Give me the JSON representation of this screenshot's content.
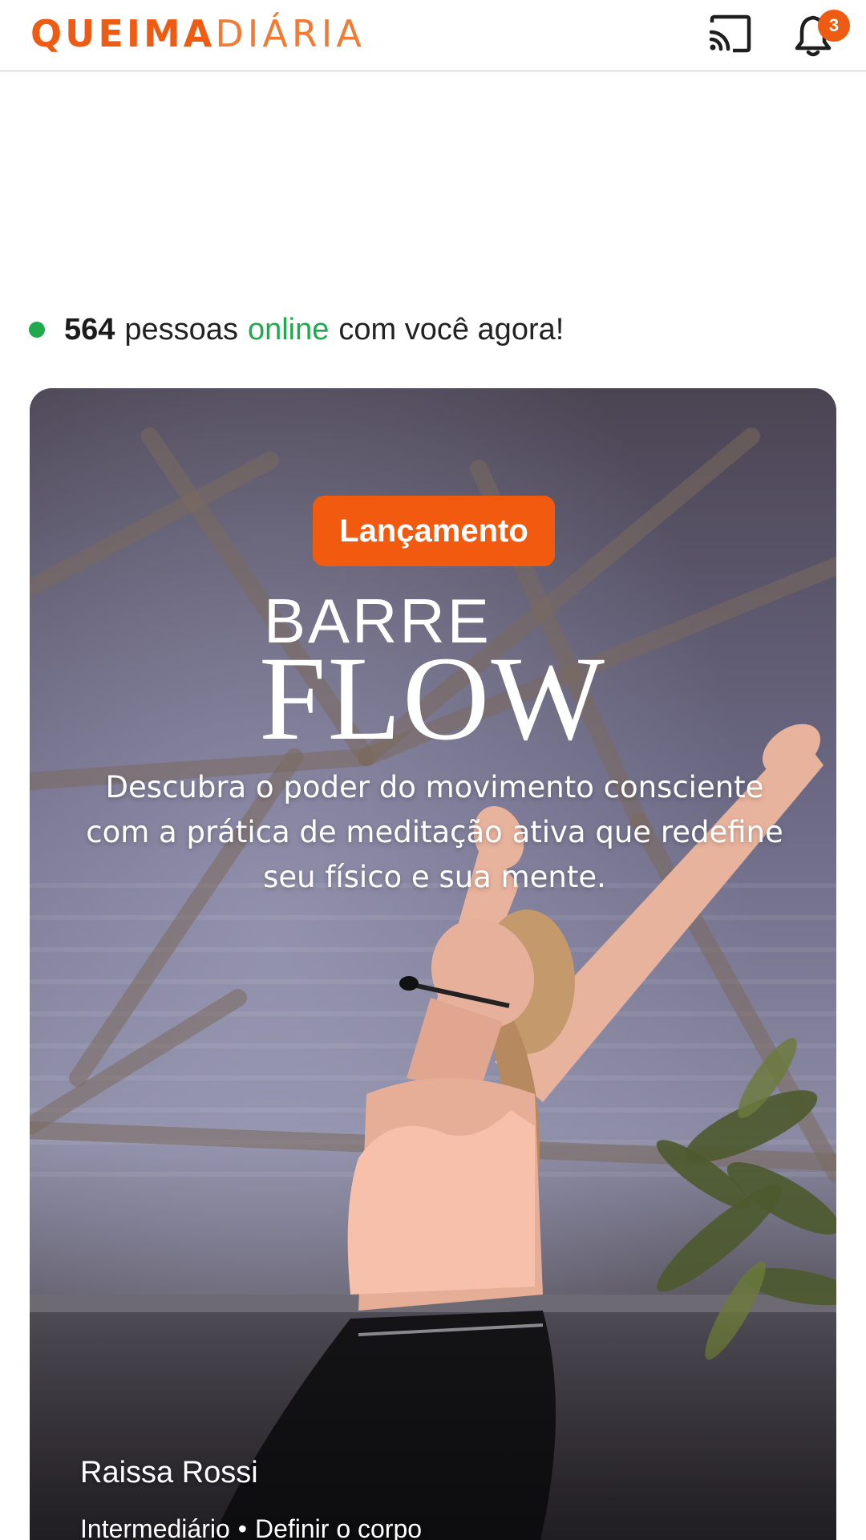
{
  "header": {
    "logo_strong": "QUEIMA",
    "logo_light": "DIÁRIA",
    "cast_icon": "cast-icon",
    "bell_icon": "bell-icon",
    "notification_count": "3"
  },
  "online": {
    "count": "564",
    "text_before": "pessoas",
    "highlight": "online",
    "text_after": "com você agora!"
  },
  "hero": {
    "badge": "Lançamento",
    "title_top": "BARRE",
    "title_main": "FLOW",
    "tagline": "Descubra o poder do movimento consciente com a prática de meditação ativa que redefine seu físico e sua mente.",
    "instructor": "Raissa Rossi",
    "level": "Intermediário",
    "separator": "•",
    "goal": "Definir o corpo"
  },
  "colors": {
    "brand_orange": "#ee5b12",
    "online_green": "#1faa4e",
    "badge_orange": "#f25a0f"
  }
}
